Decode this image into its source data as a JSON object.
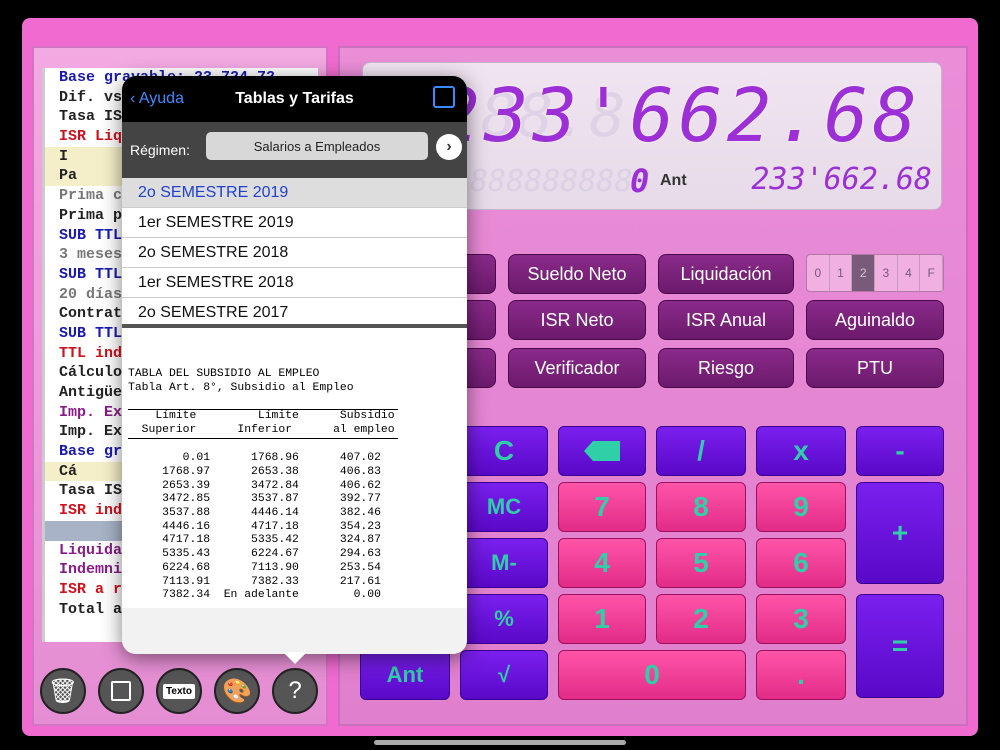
{
  "tape": [
    {
      "t": "Base gravable: 23,724.72",
      "c": "c-blue"
    },
    {
      "t": "Dif. vs",
      "c": "c-dark"
    },
    {
      "t": "Tasa IS",
      "c": "c-dark"
    },
    {
      "t": "ISR Liq",
      "c": "c-red"
    },
    {
      "t": "       I",
      "c": "c-dark",
      "hl": true
    },
    {
      "t": "      Pa",
      "c": "c-dark",
      "hl": true
    },
    {
      "t": "Prima c",
      "c": "c-gray"
    },
    {
      "t": "Prima p",
      "c": "c-dark"
    },
    {
      "t": "SUB TTL",
      "c": "c-blue"
    },
    {
      "t": "3 meses",
      "c": "c-gray"
    },
    {
      "t": "SUB TTL",
      "c": "c-blue"
    },
    {
      "t": "20 días",
      "c": "c-gray"
    },
    {
      "t": "Contrat",
      "c": "c-dark"
    },
    {
      "t": "SUB TTL",
      "c": "c-blue"
    },
    {
      "t": "TTL ind",
      "c": "c-red"
    },
    {
      "t": "Cálculo",
      "c": "c-dark"
    },
    {
      "t": "Antigüe",
      "c": "c-dark"
    },
    {
      "t": "Imp. Ex",
      "c": "c-purple"
    },
    {
      "t": "Imp. Ex",
      "c": "c-dark"
    },
    {
      "t": "Base gr",
      "c": "c-blue"
    },
    {
      "t": "    Cá",
      "c": "c-dark",
      "hl": true
    },
    {
      "t": "Tasa IS",
      "c": "c-dark"
    },
    {
      "t": "ISR ind",
      "c": "c-red"
    },
    {
      "t": "",
      "c": "c-dark",
      "sel": true
    },
    {
      "t": "Liquida",
      "c": "c-purple"
    },
    {
      "t": "Indemni",
      "c": "c-purple"
    },
    {
      "t": "ISR a r",
      "c": "c-red"
    },
    {
      "t": "Total a",
      "c": "c-dark"
    }
  ],
  "display": {
    "main": "233'662.68",
    "memory": "0",
    "ant_label": "Ant",
    "ant_value": "233'662.68",
    "ghost": "88.8",
    "mem_ghost": "8888888888"
  },
  "functions": {
    "sueldo_neto": "Sueldo Neto",
    "liquidacion": "Liquidación",
    "isr_neto": "ISR Neto",
    "isr_anual": "ISR Anual",
    "aguinaldo": "Aguinaldo",
    "verificador": "Verificador",
    "riesgo": "Riesgo",
    "ptu": "PTU"
  },
  "decimals": [
    "0",
    "1",
    "2",
    "3",
    "4",
    "F"
  ],
  "decimals_selected": "2",
  "keys": {
    "c": "C",
    "div": "/",
    "mul": "x",
    "minus": "-",
    "mc": "MC",
    "plus": "+",
    "mminus": "M-",
    "pct": "%",
    "eq": "=",
    "ant": "Ant",
    "sqrt": "√",
    "k0": "0",
    "dot": ".",
    "k1": "1",
    "k2": "2",
    "k3": "3",
    "k4": "4",
    "k5": "5",
    "k6": "6",
    "k7": "7",
    "k8": "8",
    "k9": "9"
  },
  "toolbar": {
    "texto": "Texto",
    "help": "?"
  },
  "popover": {
    "back": "Ayuda",
    "title": "Tablas y Tarifas",
    "regimen_label": "Régimen:",
    "regimen_value": "Salarios a Empleados",
    "periods": [
      "2o SEMESTRE 2019",
      "1er SEMESTRE 2019",
      "2o SEMESTRE 2018",
      "1er SEMESTRE 2018",
      "2o  SEMESTRE 2017"
    ],
    "table_title": "TABLA DEL SUBSIDIO AL EMPLEO",
    "table_subtitle": "Tabla Art. 8°, Subsidio al Empleo",
    "headers1": [
      "Límite",
      "Límite",
      "Subsidio"
    ],
    "headers2": [
      "Superior",
      "Inferior",
      "al empleo"
    ],
    "rows": [
      [
        "0.01",
        "1768.96",
        "407.02"
      ],
      [
        "1768.97",
        "2653.38",
        "406.83"
      ],
      [
        "2653.39",
        "3472.84",
        "406.62"
      ],
      [
        "3472.85",
        "3537.87",
        "392.77"
      ],
      [
        "3537.88",
        "4446.14",
        "382.46"
      ],
      [
        "4446.16",
        "4717.18",
        "354.23"
      ],
      [
        "4717.18",
        "5335.42",
        "324.87"
      ],
      [
        "5335.43",
        "6224.67",
        "294.63"
      ],
      [
        "6224.68",
        "7113.90",
        "253.54"
      ],
      [
        "7113.91",
        "7382.33",
        "217.61"
      ],
      [
        "7382.34",
        "En adelante",
        "0.00"
      ]
    ]
  }
}
